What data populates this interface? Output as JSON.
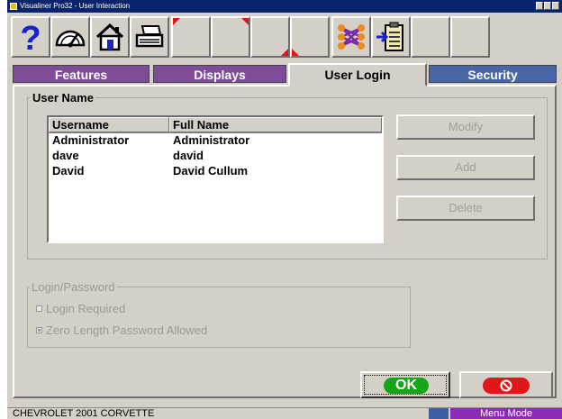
{
  "window": {
    "title": "Visualiner Pro32 - User Interaction"
  },
  "toolbar": {
    "buttons": [
      {
        "icon": "help-icon"
      },
      {
        "icon": "gauge-icon"
      },
      {
        "icon": "home-icon"
      },
      {
        "icon": "printer-icon"
      },
      {
        "icon": "blank"
      },
      {
        "icon": "blank"
      },
      {
        "icon": "blank"
      },
      {
        "icon": "blank"
      },
      {
        "icon": "network-icon"
      },
      {
        "icon": "clipboard-icon"
      },
      {
        "icon": "blank"
      },
      {
        "icon": "blank"
      }
    ]
  },
  "tabs": [
    {
      "label": "Features",
      "color": "#7e4c98"
    },
    {
      "label": "Displays",
      "color": "#7e4c98"
    },
    {
      "label": "User Login",
      "active": true
    },
    {
      "label": "Security",
      "color": "#4966a8"
    }
  ],
  "user_name_group": {
    "title": "User Name",
    "columns": [
      "Username",
      "Full Name"
    ],
    "rows": [
      {
        "username": "Administrator",
        "full_name": "Administrator"
      },
      {
        "username": "dave",
        "full_name": "david"
      },
      {
        "username": "David",
        "full_name": "David Cullum"
      }
    ],
    "buttons": {
      "modify": "Modify",
      "add": "Add",
      "delete": "Delete"
    }
  },
  "login_group": {
    "title": "Login/Password",
    "login_required": {
      "label": "Login Required",
      "checked": false
    },
    "zero_length": {
      "label": "Zero Length Password Allowed",
      "checked": true
    }
  },
  "actions": {
    "ok": "OK"
  },
  "status": {
    "vehicle": "CHEVROLET 2001 CORVETTE",
    "mode": "Menu Mode"
  }
}
